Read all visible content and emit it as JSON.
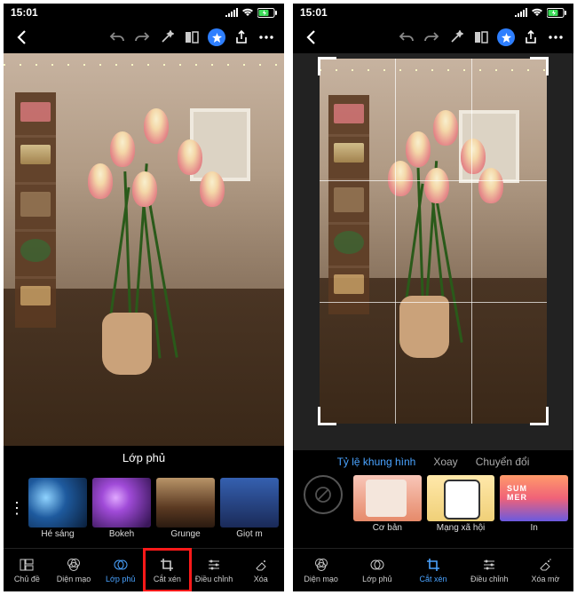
{
  "status": {
    "time": "15:01"
  },
  "toolbar_icons": {
    "back": "back-chevron",
    "undo": "undo",
    "redo": "redo",
    "wand": "magic-wand",
    "compare": "compare",
    "star": "star",
    "share": "share",
    "more": "more"
  },
  "left": {
    "section_title": "Lớp phủ",
    "thumbs": [
      {
        "label": "Hé sáng",
        "bg": "bg-hesang"
      },
      {
        "label": "Bokeh",
        "bg": "bg-bokeh"
      },
      {
        "label": "Grunge",
        "bg": "bg-grunge"
      },
      {
        "label": "Giọt m",
        "bg": "bg-giotm"
      }
    ],
    "nav": [
      {
        "label": "Chủ đề",
        "icon": "theme"
      },
      {
        "label": "Diện mạo",
        "icon": "looks"
      },
      {
        "label": "Lớp phủ",
        "icon": "overlay",
        "active": true
      },
      {
        "label": "Cắt xén",
        "icon": "crop",
        "highlight": true
      },
      {
        "label": "Điều chỉnh",
        "icon": "adjust"
      },
      {
        "label": "Xóa",
        "icon": "erase"
      }
    ]
  },
  "right": {
    "sub_tabs": [
      {
        "label": "Tỷ lệ khung hình",
        "active": true
      },
      {
        "label": "Xoay"
      },
      {
        "label": "Chuyển đổi"
      }
    ],
    "thumbs": [
      {
        "label": "Cơ bản",
        "bg": "bg-coban"
      },
      {
        "label": "Mạng xã hội",
        "bg": "bg-mxh"
      },
      {
        "label": "In",
        "bg": "bg-in"
      }
    ],
    "nav": [
      {
        "label": "Diện mạo",
        "icon": "looks"
      },
      {
        "label": "Lớp phủ",
        "icon": "overlay"
      },
      {
        "label": "Cắt xén",
        "icon": "crop",
        "active": true
      },
      {
        "label": "Điều chỉnh",
        "icon": "adjust"
      },
      {
        "label": "Xóa mờ",
        "icon": "blur"
      }
    ]
  }
}
